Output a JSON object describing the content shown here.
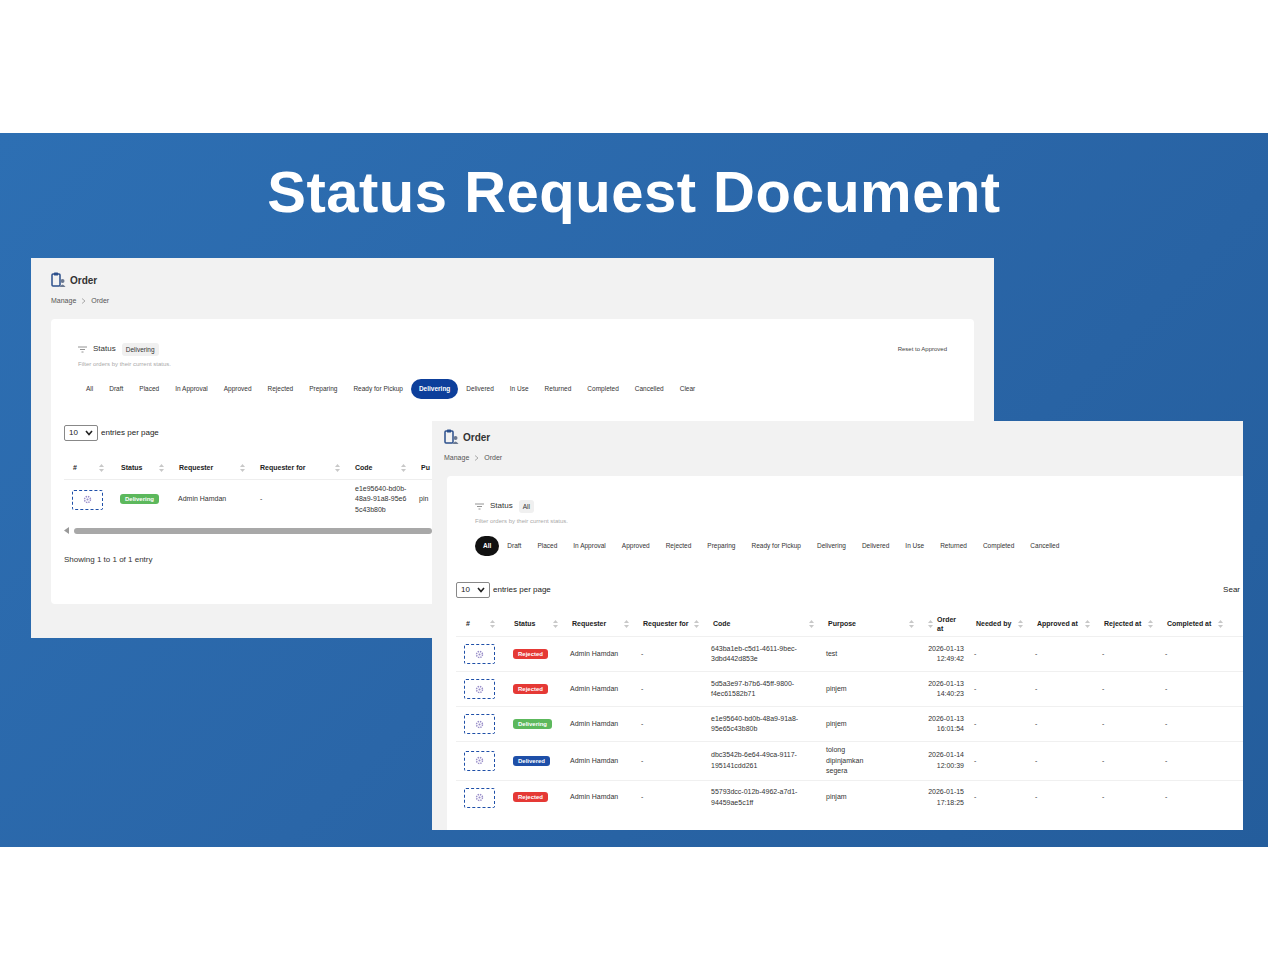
{
  "slide": {
    "title": "Status Request Document"
  },
  "window_back": {
    "title": "Order",
    "breadcrumb": [
      "Manage",
      "Order"
    ],
    "filter": {
      "label": "Status",
      "value": "Delivering",
      "hint": "Filter orders by their current status."
    },
    "reset": "Reset to Approved",
    "tabs": [
      {
        "label": "All",
        "selected": false
      },
      {
        "label": "Draft",
        "selected": false
      },
      {
        "label": "Placed",
        "selected": false
      },
      {
        "label": "In Approval",
        "selected": false
      },
      {
        "label": "Approved",
        "selected": false
      },
      {
        "label": "Rejected",
        "selected": false
      },
      {
        "label": "Preparing",
        "selected": false
      },
      {
        "label": "Ready for Pickup",
        "selected": false
      },
      {
        "label": "Delivering",
        "selected": true
      },
      {
        "label": "Delivered",
        "selected": false
      },
      {
        "label": "In Use",
        "selected": false
      },
      {
        "label": "Returned",
        "selected": false
      },
      {
        "label": "Completed",
        "selected": false
      },
      {
        "label": "Cancelled",
        "selected": false
      },
      {
        "label": "Clear",
        "selected": false
      }
    ],
    "page_size": "10",
    "page_size_label": "entries per page",
    "columns": [
      "#",
      "Status",
      "Requester",
      "Requester for",
      "Code",
      "Pu"
    ],
    "rows": [
      {
        "status": {
          "label": "Delivering",
          "color": "#5cb85c"
        },
        "requester": "Admin Hamdan",
        "requester_for": "-",
        "code": "e1e95640-bd0b-48a9-91a8-95e65c43b80b",
        "purpose": "pin"
      }
    ],
    "footer": "Showing 1 to 1 of 1 entry"
  },
  "window_front": {
    "title": "Order",
    "breadcrumb": [
      "Manage",
      "Order"
    ],
    "filter": {
      "label": "Status",
      "value": "All",
      "hint": "Filter orders by their current status."
    },
    "tabs": [
      {
        "label": "All",
        "selected": true
      },
      {
        "label": "Draft",
        "selected": false
      },
      {
        "label": "Placed",
        "selected": false
      },
      {
        "label": "In Approval",
        "selected": false
      },
      {
        "label": "Approved",
        "selected": false
      },
      {
        "label": "Rejected",
        "selected": false
      },
      {
        "label": "Preparing",
        "selected": false
      },
      {
        "label": "Ready for Pickup",
        "selected": false
      },
      {
        "label": "Delivering",
        "selected": false
      },
      {
        "label": "Delivered",
        "selected": false
      },
      {
        "label": "In Use",
        "selected": false
      },
      {
        "label": "Returned",
        "selected": false
      },
      {
        "label": "Completed",
        "selected": false
      },
      {
        "label": "Cancelled",
        "selected": false
      }
    ],
    "page_size": "10",
    "page_size_label": "entries per page",
    "search": "Sear",
    "columns": [
      "#",
      "Status",
      "Requester",
      "Requester for",
      "Code",
      "Purpose",
      "Order at",
      "Needed by",
      "Approved at",
      "Rejected at",
      "Completed at"
    ],
    "rows": [
      {
        "status": {
          "label": "Rejected",
          "color": "#e53935"
        },
        "requester": "Admin Hamdan",
        "requester_for": "-",
        "code": "643ba1eb-c5d1-4611-9bec-3dbd442d853e",
        "purpose": "test",
        "order_at": "2026-01-13 12:49:42",
        "needed_by": "-",
        "approved_at": "-",
        "rejected_at": "-",
        "completed_at": "-"
      },
      {
        "status": {
          "label": "Rejected",
          "color": "#e53935"
        },
        "requester": "Admin Hamdan",
        "requester_for": "-",
        "code": "5d5a3e97-b7b6-45ff-9800-f4ec61582b71",
        "purpose": "pinjem",
        "order_at": "2026-01-13 14:40:23",
        "needed_by": "-",
        "approved_at": "-",
        "rejected_at": "-",
        "completed_at": "-"
      },
      {
        "status": {
          "label": "Delivering",
          "color": "#5cb85c"
        },
        "requester": "Admin Hamdan",
        "requester_for": "-",
        "code": "e1e95640-bd0b-48a9-91a8-95e65c43b80b",
        "purpose": "pinjem",
        "order_at": "2026-01-13 16:01:54",
        "needed_by": "-",
        "approved_at": "-",
        "rejected_at": "-",
        "completed_at": "-"
      },
      {
        "status": {
          "label": "Delivered",
          "color": "#1e4fa8"
        },
        "requester": "Admin Hamdan",
        "requester_for": "-",
        "code": "dbc3542b-6e64-49ca-9117-195141cdd261",
        "purpose": "tolong dipinjamkan segera",
        "order_at": "2026-01-14 12:00:39",
        "needed_by": "-",
        "approved_at": "-",
        "rejected_at": "-",
        "completed_at": "-"
      },
      {
        "status": {
          "label": "Rejected",
          "color": "#e53935"
        },
        "requester": "Admin Hamdan",
        "requester_for": "-",
        "code": "55793dcc-012b-4962-a7d1-94459ae5c1ff",
        "purpose": "pinjam",
        "order_at": "2026-01-15 17:18:25",
        "needed_by": "-",
        "approved_at": "-",
        "rejected_at": "-",
        "completed_at": "-"
      }
    ]
  }
}
